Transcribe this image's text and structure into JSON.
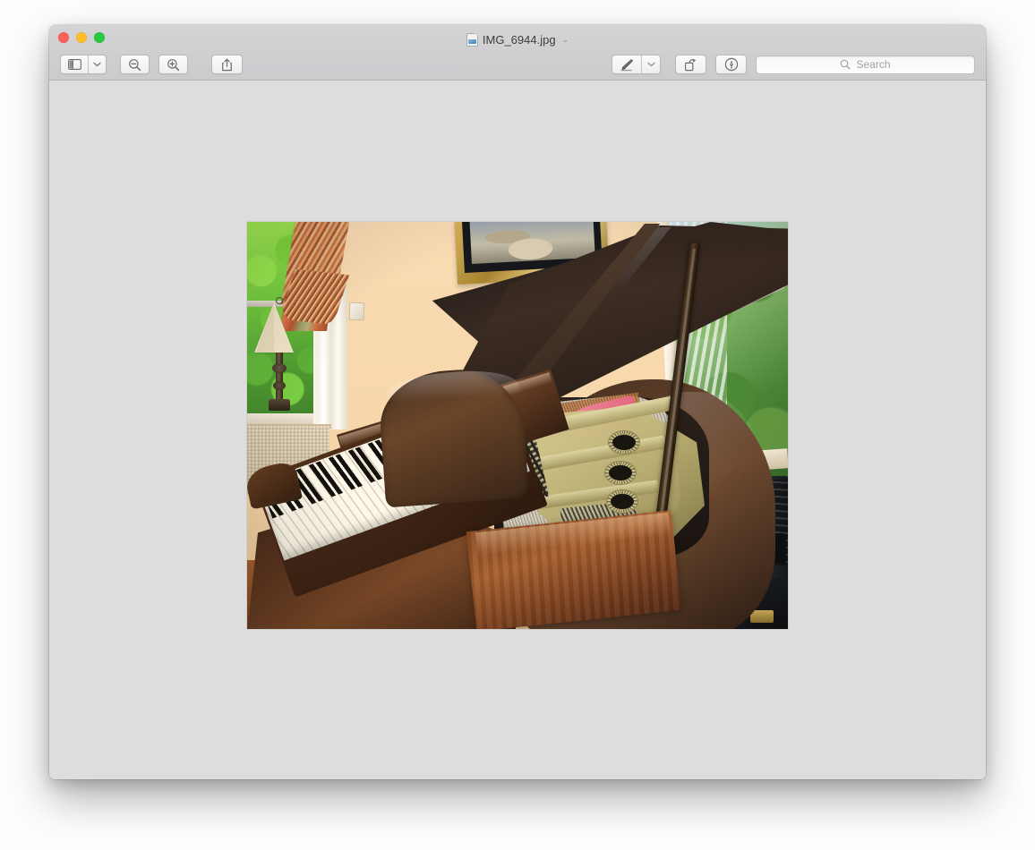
{
  "window": {
    "app": "Preview",
    "title": "IMG_6944.jpg",
    "title_chevron": "⌄",
    "doc_icon": "jpeg-document-icon",
    "traffic_lights": [
      {
        "name": "close-button",
        "color": "#ff5f57",
        "label": "Close"
      },
      {
        "name": "minimize-button",
        "color": "#ffbd2e",
        "label": "Minimize"
      },
      {
        "name": "zoom-button",
        "color": "#28c840",
        "label": "Zoom"
      }
    ],
    "chrome_colors": {
      "titlebar_top": "#d4d4d6",
      "titlebar_bottom": "#cbcbce",
      "separator": "#b0b0b3",
      "content_background": "#dddddd",
      "button_face": "#fbfbfb",
      "button_border": "#b9b9bc"
    }
  },
  "toolbar": {
    "left": [
      {
        "name": "sidebar-toggle-button",
        "icon": "sidebar-icon",
        "label": "Sidebar"
      },
      {
        "name": "sidebar-dropdown-button",
        "icon": "chevron-down-icon",
        "label": ""
      },
      {
        "name": "zoom-out-button",
        "icon": "magnifier-minus-icon",
        "label": "Zoom Out"
      },
      {
        "name": "zoom-in-button",
        "icon": "magnifier-plus-icon",
        "label": "Zoom In"
      },
      {
        "name": "share-button",
        "icon": "share-icon",
        "label": "Share"
      }
    ],
    "right": [
      {
        "name": "markup-pen-button",
        "icon": "marker-pen-icon",
        "label": "Markup"
      },
      {
        "name": "markup-dropdown-button",
        "icon": "chevron-down-icon",
        "label": ""
      },
      {
        "name": "rotate-button",
        "icon": "rotate-left-icon",
        "label": "Rotate Left"
      },
      {
        "name": "annotate-button",
        "icon": "pen-nib-circle-icon",
        "label": "Show Markup Toolbar"
      }
    ]
  },
  "search": {
    "icon": "search-icon",
    "placeholder": "Search",
    "value": ""
  },
  "image": {
    "file_name": "IMG_6944.jpg",
    "alt": "Interior photo of an open grand piano in a living room: mahogany case with the lid propped open, gold harp plate with round holes over the strings, angled keyboard of white and black keys, sunlit windows with green foliage, an orange and sage curtain with tassel valance, a table lamp with a cream shade, a gold-framed picture on a peach wall, and a black suitcase beside the piano.",
    "display_width": 604,
    "display_height": 455,
    "subjects": [
      "grand-piano",
      "piano-keyboard",
      "gold-harp-plate",
      "piano-strings",
      "lid-prop-stick",
      "window-with-trees",
      "table-lamp",
      "curtain-valance",
      "framed-picture",
      "black-suitcase",
      "hardwood-floor"
    ]
  }
}
